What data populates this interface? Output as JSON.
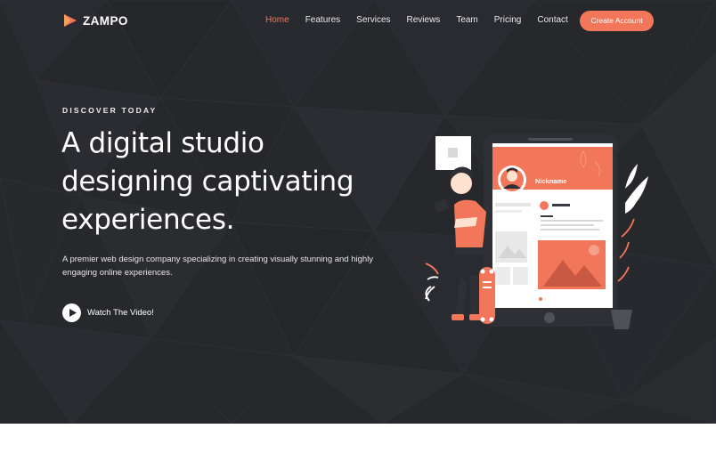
{
  "brand": {
    "name": "ZAMPO",
    "accent": "#f2775a"
  },
  "nav": {
    "items": [
      "Home",
      "Features",
      "Services",
      "Reviews",
      "Team",
      "Pricing",
      "Contact"
    ],
    "active": "Home",
    "cta_label": "Create Account"
  },
  "hero": {
    "eyebrow": "DISCOVER TODAY",
    "headline_lines": [
      "A digital studio",
      "designing captivating",
      "experiences."
    ],
    "description": "A premier web design company specializing in creating visually stunning and highly engaging online experiences.",
    "video_label": "Watch The Video!",
    "illustration": {
      "profile_name": "Nickname"
    }
  },
  "colors": {
    "background": "#27282c",
    "accent": "#f2775a"
  },
  "icons": {
    "logo": "play-triangle-logo-icon",
    "video": "play-icon"
  }
}
